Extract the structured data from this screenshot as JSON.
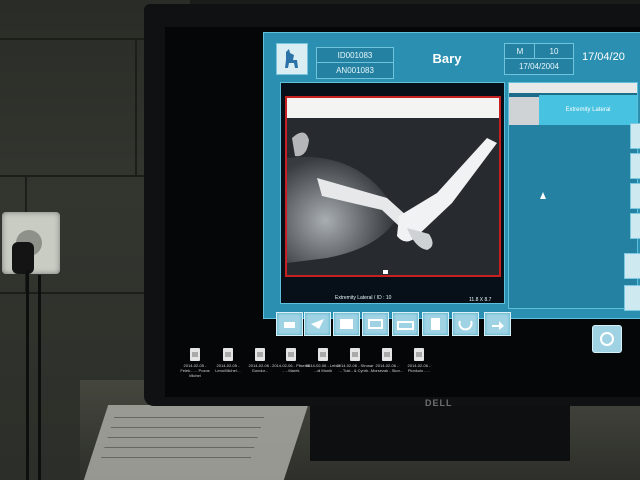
{
  "app": {
    "id_top": "ID001083",
    "id_bottom": "AN001083",
    "patient_name": "Bary",
    "sex": "M",
    "age": "10",
    "birth_date": "17/04/2004",
    "exam_date": "17/04/20",
    "logo_icon": "dog-icon",
    "accent_color": "#2a8fb0",
    "selection_color": "#c62020"
  },
  "viewer": {
    "caption": "Extremity Lateral / ID : 10",
    "scale": "11.8 X 8.7"
  },
  "side_panel": {
    "thumbnail_label": "Extremity Lateral"
  },
  "toolbar": {
    "icons": [
      "print-icon",
      "send-icon",
      "window-icon",
      "film-icon",
      "toolbox-icon",
      "blank-page-icon",
      "undo-icon",
      "transfer-icon"
    ],
    "corner_icon": "circle-icon"
  },
  "desktop": {
    "monitor_brand": "DELL",
    "icons": [
      {
        "label": "2014-02-05 - Felek...… Pozos Michel"
      },
      {
        "label": "2014-02-05 - Leno/Michel…"
      },
      {
        "label": "2014-02-06 - Gondur..."
      },
      {
        "label": "2014-02-06 - Plisetsk - ...Marek"
      },
      {
        "label": "2014-02-06 - Lebur ...di Monik"
      },
      {
        "label": "2014-02-06 - Strusar ... Tuki - & Cynth..."
      },
      {
        "label": "2014-02-06 - Morsezak - Skor..."
      },
      {
        "label": "2014-02-06 - Pionkulo - ..."
      }
    ]
  }
}
